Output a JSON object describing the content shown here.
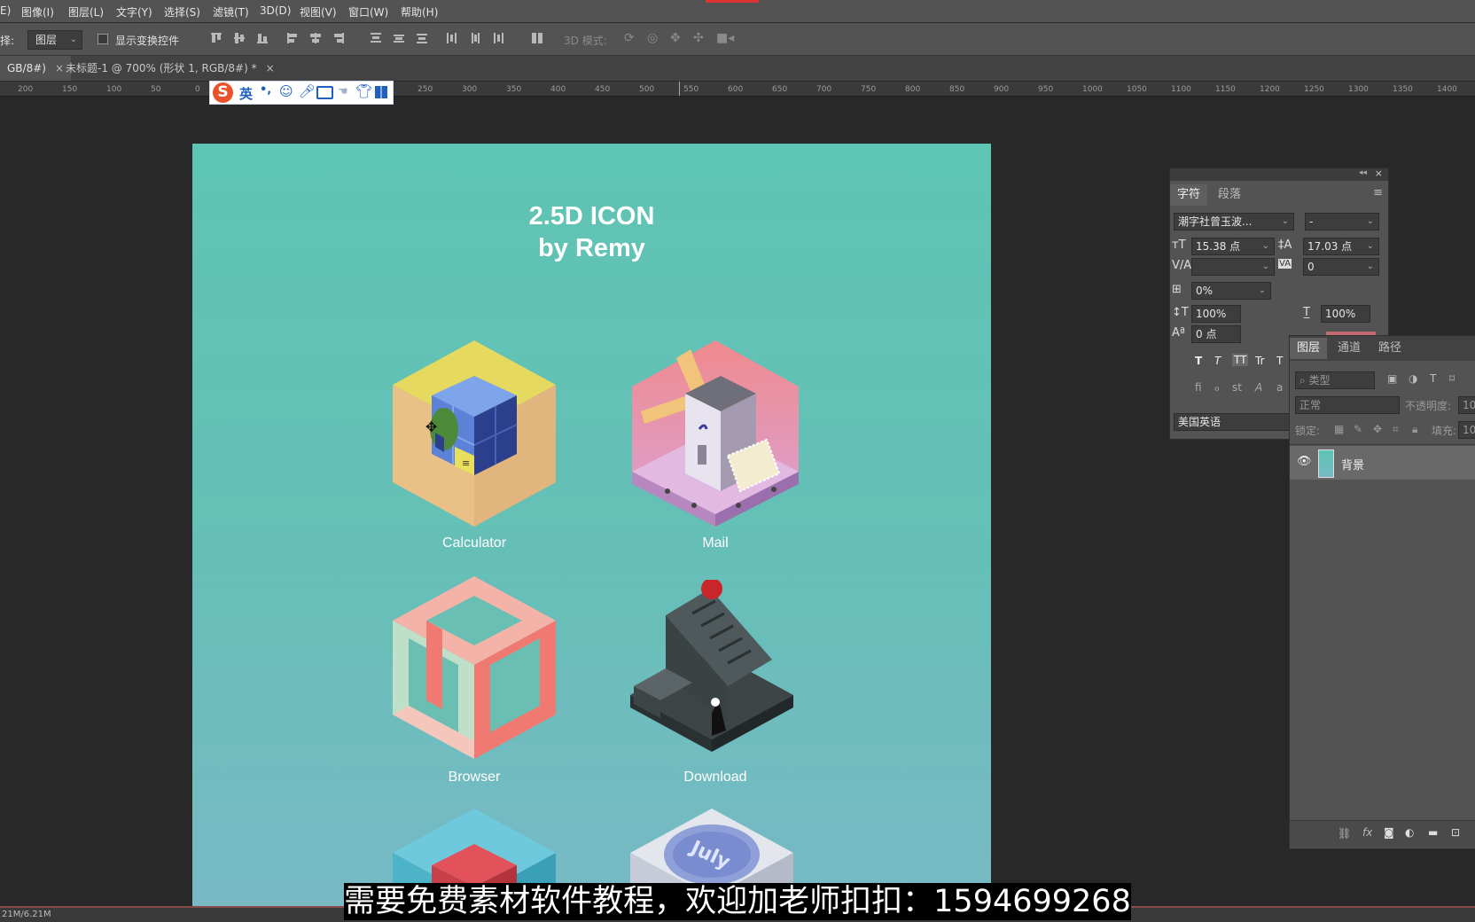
{
  "menu": [
    "E)",
    "图像(I)",
    "图层(L)",
    "文字(Y)",
    "选择(S)",
    "滤镜(T)",
    "3D(D)",
    "视图(V)",
    "窗口(W)",
    "帮助(H)"
  ],
  "options": {
    "select_label": "择:",
    "select_value": "图层",
    "show_transform": "显示变换控件",
    "mode_3d": "3D 模式:"
  },
  "tabs": [
    {
      "label": "GB/8#)",
      "close": "×"
    },
    {
      "label": "未标题-1 @ 700% (形状 1, RGB/8#) *",
      "close": "×"
    }
  ],
  "ruler_ticks": [
    "200",
    "150",
    "100",
    "50",
    "0",
    "250",
    "300",
    "350",
    "400",
    "450",
    "500",
    "550",
    "600",
    "650",
    "700",
    "750",
    "800",
    "850",
    "900",
    "950",
    "1000",
    "1050",
    "1100",
    "1150",
    "1200",
    "1250",
    "1300",
    "1350",
    "1400"
  ],
  "ime": {
    "logo": "S",
    "lang": "英",
    "punct": "•,"
  },
  "canvas": {
    "title_line1": "2.5D ICON",
    "title_line2": "by Remy",
    "icons": [
      {
        "label": "Calculator"
      },
      {
        "label": "Mail"
      },
      {
        "label": "Browser"
      },
      {
        "label": "Download"
      }
    ],
    "partial_icon_text": "July"
  },
  "character_panel": {
    "tab_char": "字符",
    "tab_para": "段落",
    "font_family": "潮字社曾玉波...",
    "font_style": "-",
    "font_size": "15.38 点",
    "leading": "17.03 点",
    "kerning": "",
    "tracking": "0",
    "scale_pct": "0%",
    "vscale": "100%",
    "hscale": "100%",
    "baseline": "0 点",
    "language": "美国英语",
    "style_buttons": [
      "T",
      "T",
      "TT",
      "Tr",
      "T"
    ],
    "opentype_buttons": [
      "fi",
      "ℴ",
      "st",
      "A",
      "a"
    ]
  },
  "layers_panel": {
    "tab_layers": "图层",
    "tab_channels": "通道",
    "tab_paths": "路径",
    "filter_placeholder": "类型",
    "blend_mode": "正常",
    "opacity_label": "不透明度:",
    "opacity_value": "10",
    "lock_label": "锁定:",
    "fill_label": "填充:",
    "fill_value": "10",
    "layer_name": "背景"
  },
  "status": {
    "doc_size": "21M/6.21M"
  },
  "subtitle": "需要免费素材软件教程，欢迎加老师扣扣：1594699268",
  "colors": {
    "canvas_top": "#5ec4b3",
    "canvas_bottom": "#78b9c5",
    "ui_bg": "#535353",
    "workspace": "#282828"
  }
}
